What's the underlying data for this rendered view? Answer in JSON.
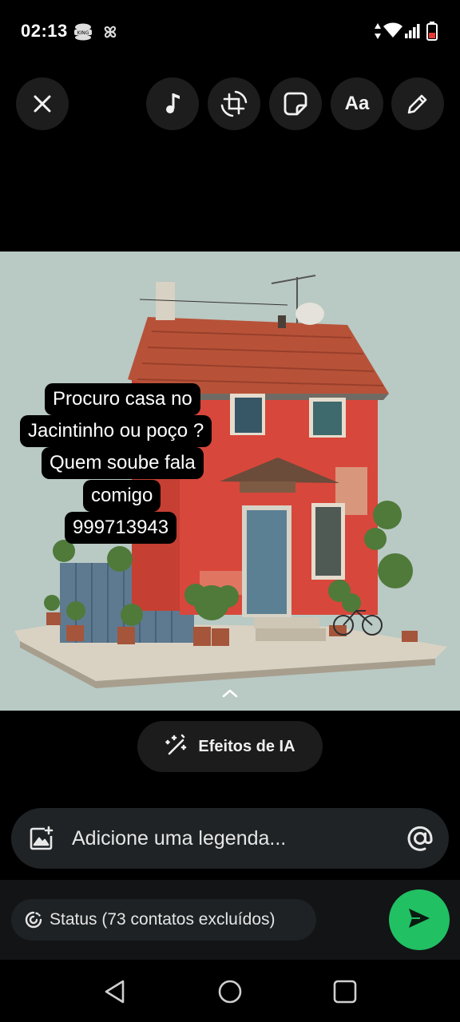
{
  "status_bar": {
    "time": "02:13",
    "icons": [
      "burger-king-notification-icon",
      "pinwheel-app-icon",
      "data-arrows-icon",
      "wifi-icon",
      "signal-icon",
      "battery-low-icon"
    ]
  },
  "toolbar": {
    "close": "close-icon",
    "music": "music-icon",
    "crop_rotate": "crop-rotate-icon",
    "sticker": "sticker-icon",
    "text_label": "Aa",
    "draw": "pencil-icon"
  },
  "image_overlay": {
    "lines": [
      "Procuro casa no",
      "Jacintinho ou poço ?",
      "Quem soube fala",
      "comigo",
      "999713943"
    ]
  },
  "ai_effects": {
    "label": "Efeitos de IA"
  },
  "caption": {
    "placeholder": "Adicione uma legenda..."
  },
  "status_chip": {
    "label": "Status (73 contatos excluídos)"
  },
  "colors": {
    "send_button": "#21c063",
    "photo_background": "#b9c9c4",
    "house_wall": "#d8473b"
  }
}
